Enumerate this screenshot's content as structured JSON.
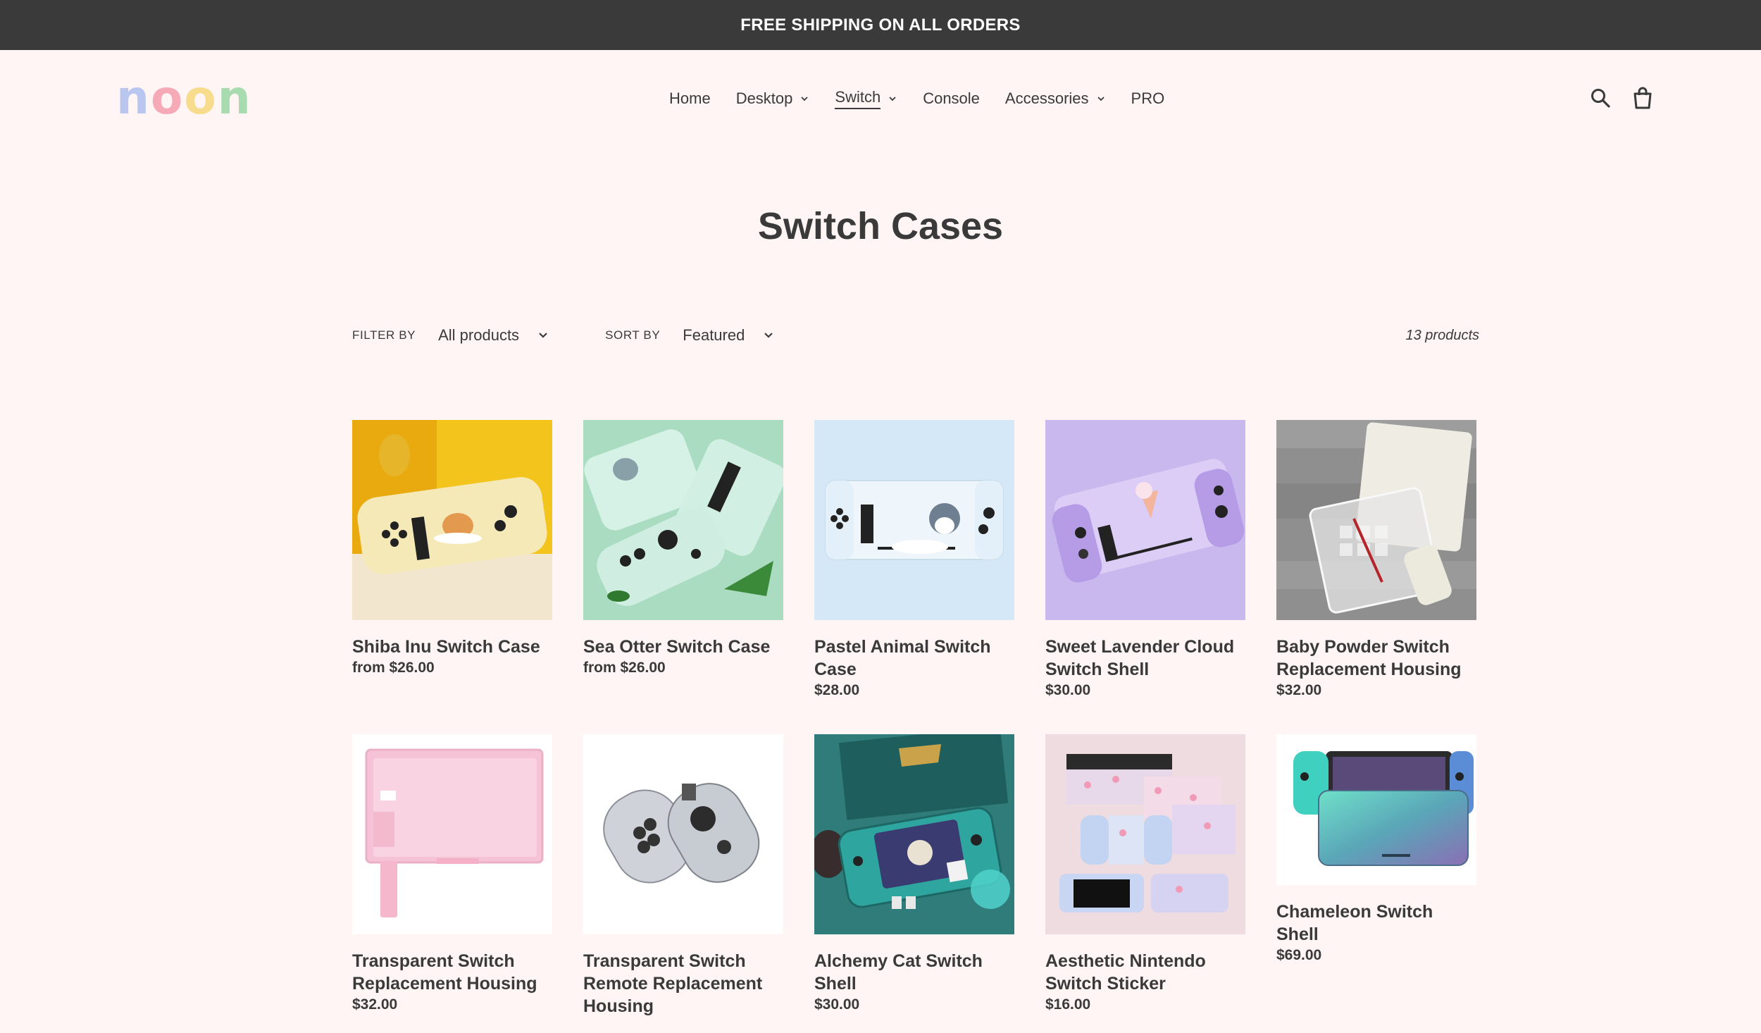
{
  "announcement": "FREE SHIPPING ON ALL ORDERS",
  "brand": {
    "letters": [
      "n",
      "o",
      "o",
      "n"
    ],
    "colors": [
      "#b8c6f0",
      "#f6a9b6",
      "#f6dc8c",
      "#a8dcb0"
    ]
  },
  "nav": [
    {
      "label": "Home",
      "dropdown": false
    },
    {
      "label": "Desktop",
      "dropdown": true
    },
    {
      "label": "Switch",
      "dropdown": true,
      "active": true
    },
    {
      "label": "Console",
      "dropdown": false
    },
    {
      "label": "Accessories",
      "dropdown": true
    },
    {
      "label": "PRO",
      "dropdown": false
    }
  ],
  "header_icons": [
    "search-icon",
    "cart-icon"
  ],
  "page_title": "Switch Cases",
  "toolbar": {
    "filter_label": "FILTER BY",
    "filter_value": "All products",
    "sort_label": "SORT BY",
    "sort_value": "Featured",
    "count": "13 products"
  },
  "products": [
    {
      "title": "Shiba Inu Switch Case",
      "price": "from $26.00"
    },
    {
      "title": "Sea Otter Switch Case",
      "price": "from $26.00"
    },
    {
      "title": "Pastel Animal Switch Case",
      "price": "$28.00"
    },
    {
      "title": "Sweet Lavender Cloud Switch Shell",
      "price": "$30.00"
    },
    {
      "title": "Baby Powder Switch Replacement Housing",
      "price": "$32.00"
    },
    {
      "title": "Transparent Switch Replacement Housing",
      "price": "$32.00"
    },
    {
      "title": "Transparent Switch Remote Replacement Housing",
      "price": ""
    },
    {
      "title": "Alchemy Cat Switch Shell",
      "price": "$30.00"
    },
    {
      "title": "Aesthetic Nintendo Switch Sticker",
      "price": "$16.00"
    },
    {
      "title": "Chameleon Switch Shell",
      "price": "$69.00"
    }
  ],
  "colors": {
    "background": "#fff5f4",
    "announcement_bar": "#3a3a3a",
    "text": "#3a3a3a"
  }
}
